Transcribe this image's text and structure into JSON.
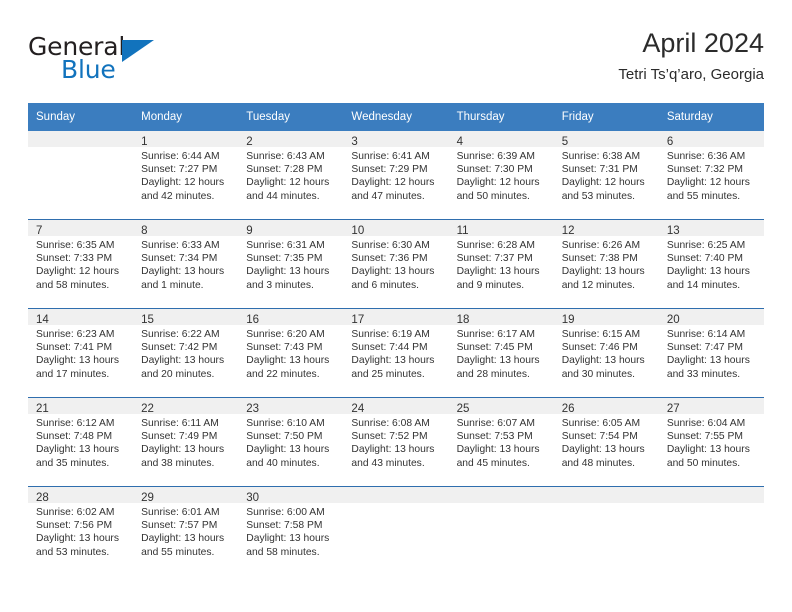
{
  "brand": {
    "name_top": "General",
    "name_bottom": "Blue",
    "accent_color": "#1273bd"
  },
  "header": {
    "title": "April 2024",
    "subtitle": "Tetri Ts’q’aro, Georgia"
  },
  "theme": {
    "header_row_color": "#3b7dbf",
    "row_divider_color": "#2f6eae",
    "daynum_strip_color": "#f0f0f0"
  },
  "weekdays": [
    "Sunday",
    "Monday",
    "Tuesday",
    "Wednesday",
    "Thursday",
    "Friday",
    "Saturday"
  ],
  "labels": {
    "sunrise_prefix": "Sunrise:",
    "sunset_prefix": "Sunset:",
    "daylight_prefix": "Daylight:"
  },
  "weeks": [
    [
      {
        "day": "",
        "sunrise": "",
        "sunset": "",
        "daylight": ""
      },
      {
        "day": "1",
        "sunrise": "Sunrise: 6:44 AM",
        "sunset": "Sunset: 7:27 PM",
        "daylight": "Daylight: 12 hours and 42 minutes."
      },
      {
        "day": "2",
        "sunrise": "Sunrise: 6:43 AM",
        "sunset": "Sunset: 7:28 PM",
        "daylight": "Daylight: 12 hours and 44 minutes."
      },
      {
        "day": "3",
        "sunrise": "Sunrise: 6:41 AM",
        "sunset": "Sunset: 7:29 PM",
        "daylight": "Daylight: 12 hours and 47 minutes."
      },
      {
        "day": "4",
        "sunrise": "Sunrise: 6:39 AM",
        "sunset": "Sunset: 7:30 PM",
        "daylight": "Daylight: 12 hours and 50 minutes."
      },
      {
        "day": "5",
        "sunrise": "Sunrise: 6:38 AM",
        "sunset": "Sunset: 7:31 PM",
        "daylight": "Daylight: 12 hours and 53 minutes."
      },
      {
        "day": "6",
        "sunrise": "Sunrise: 6:36 AM",
        "sunset": "Sunset: 7:32 PM",
        "daylight": "Daylight: 12 hours and 55 minutes."
      }
    ],
    [
      {
        "day": "7",
        "sunrise": "Sunrise: 6:35 AM",
        "sunset": "Sunset: 7:33 PM",
        "daylight": "Daylight: 12 hours and 58 minutes."
      },
      {
        "day": "8",
        "sunrise": "Sunrise: 6:33 AM",
        "sunset": "Sunset: 7:34 PM",
        "daylight": "Daylight: 13 hours and 1 minute."
      },
      {
        "day": "9",
        "sunrise": "Sunrise: 6:31 AM",
        "sunset": "Sunset: 7:35 PM",
        "daylight": "Daylight: 13 hours and 3 minutes."
      },
      {
        "day": "10",
        "sunrise": "Sunrise: 6:30 AM",
        "sunset": "Sunset: 7:36 PM",
        "daylight": "Daylight: 13 hours and 6 minutes."
      },
      {
        "day": "11",
        "sunrise": "Sunrise: 6:28 AM",
        "sunset": "Sunset: 7:37 PM",
        "daylight": "Daylight: 13 hours and 9 minutes."
      },
      {
        "day": "12",
        "sunrise": "Sunrise: 6:26 AM",
        "sunset": "Sunset: 7:38 PM",
        "daylight": "Daylight: 13 hours and 12 minutes."
      },
      {
        "day": "13",
        "sunrise": "Sunrise: 6:25 AM",
        "sunset": "Sunset: 7:40 PM",
        "daylight": "Daylight: 13 hours and 14 minutes."
      }
    ],
    [
      {
        "day": "14",
        "sunrise": "Sunrise: 6:23 AM",
        "sunset": "Sunset: 7:41 PM",
        "daylight": "Daylight: 13 hours and 17 minutes."
      },
      {
        "day": "15",
        "sunrise": "Sunrise: 6:22 AM",
        "sunset": "Sunset: 7:42 PM",
        "daylight": "Daylight: 13 hours and 20 minutes."
      },
      {
        "day": "16",
        "sunrise": "Sunrise: 6:20 AM",
        "sunset": "Sunset: 7:43 PM",
        "daylight": "Daylight: 13 hours and 22 minutes."
      },
      {
        "day": "17",
        "sunrise": "Sunrise: 6:19 AM",
        "sunset": "Sunset: 7:44 PM",
        "daylight": "Daylight: 13 hours and 25 minutes."
      },
      {
        "day": "18",
        "sunrise": "Sunrise: 6:17 AM",
        "sunset": "Sunset: 7:45 PM",
        "daylight": "Daylight: 13 hours and 28 minutes."
      },
      {
        "day": "19",
        "sunrise": "Sunrise: 6:15 AM",
        "sunset": "Sunset: 7:46 PM",
        "daylight": "Daylight: 13 hours and 30 minutes."
      },
      {
        "day": "20",
        "sunrise": "Sunrise: 6:14 AM",
        "sunset": "Sunset: 7:47 PM",
        "daylight": "Daylight: 13 hours and 33 minutes."
      }
    ],
    [
      {
        "day": "21",
        "sunrise": "Sunrise: 6:12 AM",
        "sunset": "Sunset: 7:48 PM",
        "daylight": "Daylight: 13 hours and 35 minutes."
      },
      {
        "day": "22",
        "sunrise": "Sunrise: 6:11 AM",
        "sunset": "Sunset: 7:49 PM",
        "daylight": "Daylight: 13 hours and 38 minutes."
      },
      {
        "day": "23",
        "sunrise": "Sunrise: 6:10 AM",
        "sunset": "Sunset: 7:50 PM",
        "daylight": "Daylight: 13 hours and 40 minutes."
      },
      {
        "day": "24",
        "sunrise": "Sunrise: 6:08 AM",
        "sunset": "Sunset: 7:52 PM",
        "daylight": "Daylight: 13 hours and 43 minutes."
      },
      {
        "day": "25",
        "sunrise": "Sunrise: 6:07 AM",
        "sunset": "Sunset: 7:53 PM",
        "daylight": "Daylight: 13 hours and 45 minutes."
      },
      {
        "day": "26",
        "sunrise": "Sunrise: 6:05 AM",
        "sunset": "Sunset: 7:54 PM",
        "daylight": "Daylight: 13 hours and 48 minutes."
      },
      {
        "day": "27",
        "sunrise": "Sunrise: 6:04 AM",
        "sunset": "Sunset: 7:55 PM",
        "daylight": "Daylight: 13 hours and 50 minutes."
      }
    ],
    [
      {
        "day": "28",
        "sunrise": "Sunrise: 6:02 AM",
        "sunset": "Sunset: 7:56 PM",
        "daylight": "Daylight: 13 hours and 53 minutes."
      },
      {
        "day": "29",
        "sunrise": "Sunrise: 6:01 AM",
        "sunset": "Sunset: 7:57 PM",
        "daylight": "Daylight: 13 hours and 55 minutes."
      },
      {
        "day": "30",
        "sunrise": "Sunrise: 6:00 AM",
        "sunset": "Sunset: 7:58 PM",
        "daylight": "Daylight: 13 hours and 58 minutes."
      },
      {
        "day": "",
        "sunrise": "",
        "sunset": "",
        "daylight": ""
      },
      {
        "day": "",
        "sunrise": "",
        "sunset": "",
        "daylight": ""
      },
      {
        "day": "",
        "sunrise": "",
        "sunset": "",
        "daylight": ""
      },
      {
        "day": "",
        "sunrise": "",
        "sunset": "",
        "daylight": ""
      }
    ]
  ]
}
